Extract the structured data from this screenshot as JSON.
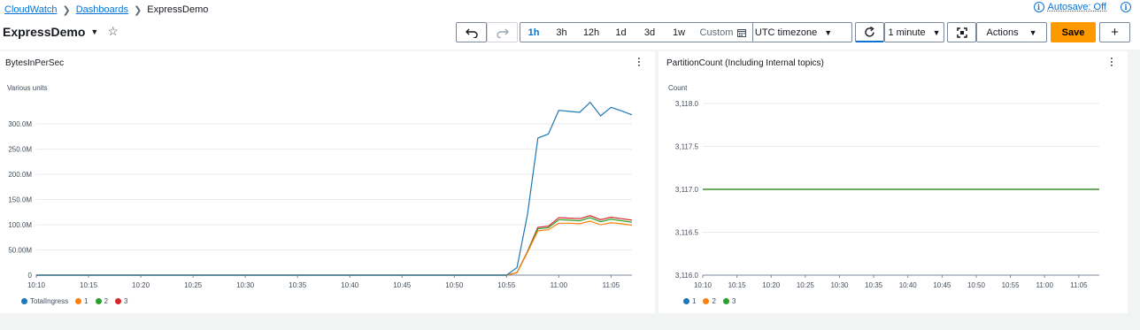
{
  "breadcrumb": {
    "root": "CloudWatch",
    "middle": "Dashboards",
    "current": "ExpressDemo"
  },
  "autosave": "Autosave: Off",
  "dashboard": {
    "title": "ExpressDemo"
  },
  "toolbar": {
    "ranges": [
      "1h",
      "3h",
      "12h",
      "1d",
      "3d",
      "1w"
    ],
    "active_range": "1h",
    "custom_label": "Custom",
    "timezone": "UTC timezone",
    "refresh_interval": "1 minute",
    "actions_label": "Actions",
    "save_label": "Save",
    "add_label": "+"
  },
  "colors": {
    "accent": "#0972d3",
    "save": "#ff9900"
  },
  "widgets": [
    {
      "title": "BytesInPerSec",
      "unit": "Various units"
    },
    {
      "title": "PartitionCount (Including Internal topics)",
      "unit": "Count"
    }
  ],
  "chart_data": [
    {
      "type": "line",
      "title": "BytesInPerSec",
      "ylabel": "Various units",
      "x": [
        "10:10",
        "10:11",
        "10:12",
        "10:13",
        "10:14",
        "10:15",
        "10:16",
        "10:17",
        "10:18",
        "10:19",
        "10:20",
        "10:21",
        "10:22",
        "10:23",
        "10:24",
        "10:25",
        "10:26",
        "10:27",
        "10:28",
        "10:29",
        "10:30",
        "10:31",
        "10:32",
        "10:33",
        "10:34",
        "10:35",
        "10:36",
        "10:37",
        "10:38",
        "10:39",
        "10:40",
        "10:41",
        "10:42",
        "10:43",
        "10:44",
        "10:45",
        "10:46",
        "10:47",
        "10:48",
        "10:49",
        "10:50",
        "10:51",
        "10:52",
        "10:53",
        "10:54",
        "10:55",
        "10:56",
        "10:57",
        "10:58",
        "10:59",
        "11:00",
        "11:01",
        "11:02",
        "11:03",
        "11:04",
        "11:05",
        "11:06",
        "11:07"
      ],
      "xticks": [
        "10:10",
        "10:15",
        "10:20",
        "10:25",
        "10:30",
        "10:35",
        "10:40",
        "10:45",
        "10:50",
        "10:55",
        "11:00",
        "11:05"
      ],
      "yticks": [
        0,
        50000000,
        100000000,
        150000000,
        200000000,
        250000000,
        300000000
      ],
      "ytick_labels": [
        "0",
        "50.00M",
        "100.0M",
        "150.0M",
        "200.0M",
        "250.0M",
        "300.0M"
      ],
      "ylim": [
        0,
        330000000
      ],
      "series": [
        {
          "name": "TotalIngress",
          "color": "#1f77b4",
          "tail": [
            0,
            15000000,
            120000000,
            272000000,
            280000000,
            327000000,
            325000000,
            323000000,
            343000000,
            316000000,
            333000000,
            326000000,
            318000000
          ]
        },
        {
          "name": "1",
          "color": "#ff7f0e",
          "tail": [
            0,
            5000000,
            45000000,
            88000000,
            90000000,
            103000000,
            103000000,
            102000000,
            107000000,
            100000000,
            104000000,
            102000000,
            99000000
          ]
        },
        {
          "name": "2",
          "color": "#2ca02c",
          "tail": [
            0,
            5000000,
            46000000,
            92000000,
            94000000,
            110000000,
            109000000,
            108000000,
            114000000,
            106000000,
            111000000,
            108000000,
            105000000
          ]
        },
        {
          "name": "3",
          "color": "#d62728",
          "tail": [
            0,
            5000000,
            47000000,
            95000000,
            97000000,
            114000000,
            113000000,
            112000000,
            118000000,
            110000000,
            115000000,
            112000000,
            109000000
          ]
        }
      ],
      "tail_start": "10:55",
      "legend": "bottom-left"
    },
    {
      "type": "line",
      "title": "PartitionCount (Including Internal topics)",
      "ylabel": "Count",
      "xticks": [
        "10:10",
        "10:15",
        "10:20",
        "10:25",
        "10:30",
        "10:35",
        "10:40",
        "10:45",
        "10:50",
        "10:55",
        "11:00",
        "11:05"
      ],
      "yticks": [
        3116.0,
        3116.5,
        3117.0,
        3117.5,
        3118.0
      ],
      "ytick_labels": [
        "3,116.0",
        "3,116.5",
        "3,117.0",
        "3,117.5",
        "3,118.0"
      ],
      "ylim": [
        3116.0,
        3118.0
      ],
      "series": [
        {
          "name": "1",
          "color": "#1f77b4",
          "value": 3117
        },
        {
          "name": "2",
          "color": "#ff7f0e",
          "value": 3117
        },
        {
          "name": "3",
          "color": "#2ca02c",
          "value": 3117
        }
      ],
      "legend": "bottom-left"
    }
  ]
}
